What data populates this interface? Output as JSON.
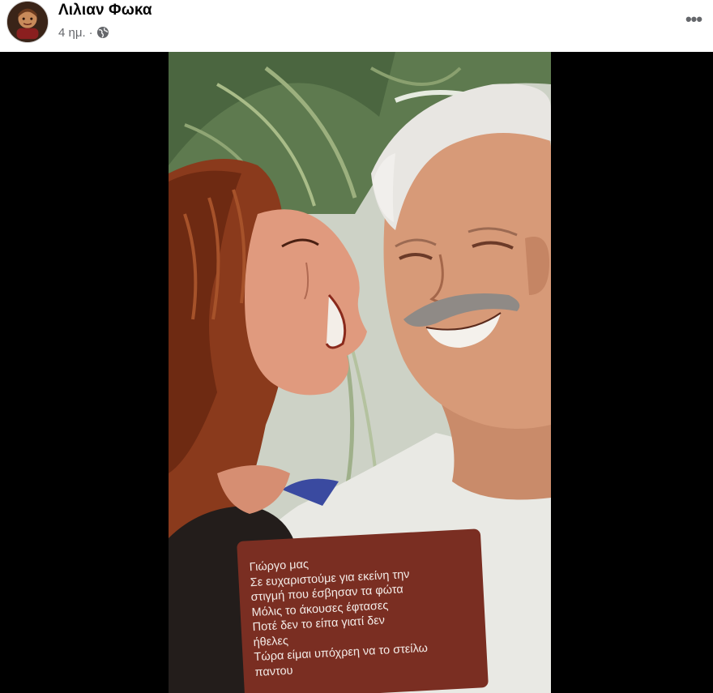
{
  "post": {
    "author_name": "Λιλιαν Φωκα",
    "timestamp": "4 ημ.",
    "separator": "·",
    "privacy_icon": "globe-icon",
    "more_icon": "more-horizontal-icon",
    "more_label": "•••"
  },
  "media": {
    "caption_lines": [
      "Γιώργο μας",
      "Σε ευχαριστούμε για εκείνη την",
      "στιγμή που έσβησαν τα φώτα",
      "Μόλις το άκουσες έφτασες",
      "Ποτέ δεν το είπα γιατί δεν",
      "ήθελες",
      "Τώρα είμαι υπόχρεη να το στείλω",
      "παντου"
    ]
  },
  "colors": {
    "caption_background": "#7a2e22",
    "caption_text": "#f3ece8",
    "media_background": "#000000",
    "meta_text": "#65676b"
  }
}
